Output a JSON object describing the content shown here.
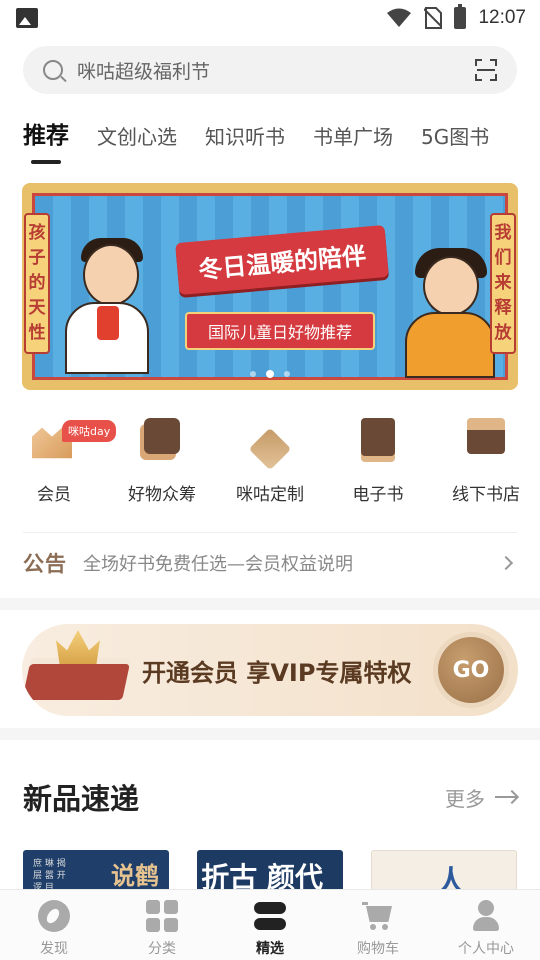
{
  "status_bar": {
    "time": "12:07"
  },
  "search": {
    "placeholder": "咪咕超级福利节"
  },
  "tabs": [
    {
      "label": "推荐"
    },
    {
      "label": "文创心选"
    },
    {
      "label": "知识听书"
    },
    {
      "label": "书单广场"
    },
    {
      "label": "5G图书"
    }
  ],
  "banner": {
    "title": "冬日温暖的陪伴",
    "subtitle": "国际儿童日好物推荐",
    "left_vertical": "孩子的天性",
    "right_vertical": "我们来释放",
    "page_count": 3,
    "active_page": 2
  },
  "quick_links": [
    {
      "label": "会员",
      "icon": "member-crown-icon",
      "badge": "咪咕day"
    },
    {
      "label": "好物众筹",
      "icon": "crowdfunding-icon"
    },
    {
      "label": "咪咕定制",
      "icon": "custom-pen-icon"
    },
    {
      "label": "电子书",
      "icon": "ebook-icon"
    },
    {
      "label": "线下书店",
      "icon": "store-icon"
    }
  ],
  "notice": {
    "tag": "公告",
    "text": "全场好书免费任选—会员权益说明"
  },
  "vip_banner": {
    "text": "开通会员 享VIP专属特权",
    "button": "GO"
  },
  "new_arrivals": {
    "title": "新品速递",
    "more": "更多",
    "covers": [
      {
        "title": "说鹤",
        "subtitle": "庶 琳 揭 层 嚣 开 逻 目"
      },
      {
        "title": "折古 颜代",
        "subtitle": ""
      },
      {
        "title": "人",
        "subtitle": ""
      }
    ]
  },
  "tabbar": [
    {
      "label": "发现",
      "icon": "discover-icon"
    },
    {
      "label": "分类",
      "icon": "category-icon"
    },
    {
      "label": "精选",
      "icon": "featured-icon",
      "active": true
    },
    {
      "label": "购物车",
      "icon": "cart-icon"
    },
    {
      "label": "个人中心",
      "icon": "user-icon"
    }
  ]
}
